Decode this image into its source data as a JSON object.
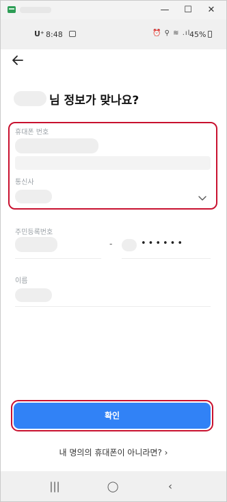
{
  "window": {
    "minimize": "—",
    "maximize": "☐",
    "close": "✕"
  },
  "status_bar": {
    "carrier": "U⁺",
    "time": "8:48",
    "icons": "⏰ ⚲ ≋ .ıl",
    "battery": "45%"
  },
  "header": {
    "back_icon": "arrow-left-icon",
    "title_suffix": "님 정보가 맞나요?"
  },
  "form": {
    "phone_label": "휴대폰 번호",
    "carrier_label": "통신사",
    "rrn_label": "주민등록번호",
    "rrn_dash": "-",
    "rrn_masked": "••••••",
    "name_label": "이름"
  },
  "confirm_button": "확인",
  "not_my_phone_link": "내 명의의 휴대폰이 아니라면? ›",
  "nav": {
    "recents": "|||",
    "home": "◯",
    "back": "‹"
  },
  "colors": {
    "primary": "#3182f6",
    "highlight": "#c8102e"
  }
}
